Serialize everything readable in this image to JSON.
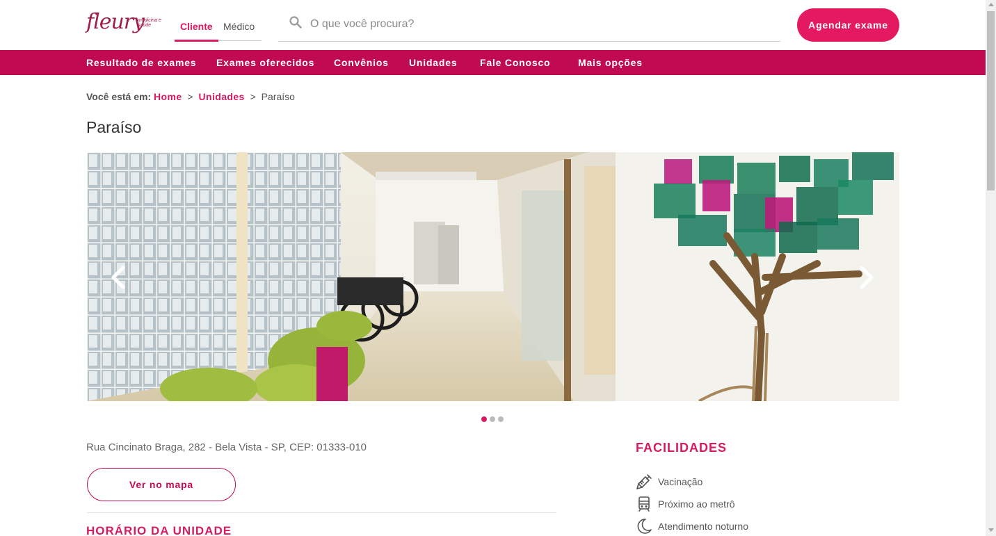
{
  "header": {
    "logo_text": "fleury",
    "logo_tagline": "medicina e saúde",
    "tabs": [
      {
        "label": "Cliente",
        "active": true
      },
      {
        "label": "Médico",
        "active": false
      }
    ],
    "search": {
      "placeholder": "O que você procura?",
      "value": ""
    },
    "cta_label": "Agendar exame"
  },
  "nav": {
    "items": [
      {
        "label": "Resultado de exames"
      },
      {
        "label": "Exames oferecidos"
      },
      {
        "label": "Convênios"
      },
      {
        "label": "Unidades"
      },
      {
        "label": "Fale Conosco"
      },
      {
        "label": "Mais opções"
      }
    ]
  },
  "breadcrumb": {
    "prefix": "Você está em:",
    "home": "Home",
    "sep": ">",
    "parent": "Unidades",
    "current": "Paraíso"
  },
  "page": {
    "title": "Paraíso"
  },
  "carousel": {
    "slide_count": 3,
    "active_index": 0,
    "image_desc": "hallway-with-glass-block-wall-and-tree-art"
  },
  "unit": {
    "address": "Rua Cincinato Braga, 282 - Bela Vista - SP, CEP: 01333-010",
    "map_button": "Ver no mapa",
    "hours_title": "HORÁRIO DA UNIDADE"
  },
  "facilities": {
    "title": "FACILIDADES",
    "items": [
      {
        "label": "Vacinação",
        "icon": "syringe-icon"
      },
      {
        "label": "Próximo ao metrô",
        "icon": "train-icon"
      },
      {
        "label": "Atendimento noturno",
        "icon": "moon-icon"
      }
    ]
  },
  "colors": {
    "brand": "#c00a52",
    "accent": "#e5195f",
    "text": "#444444"
  }
}
